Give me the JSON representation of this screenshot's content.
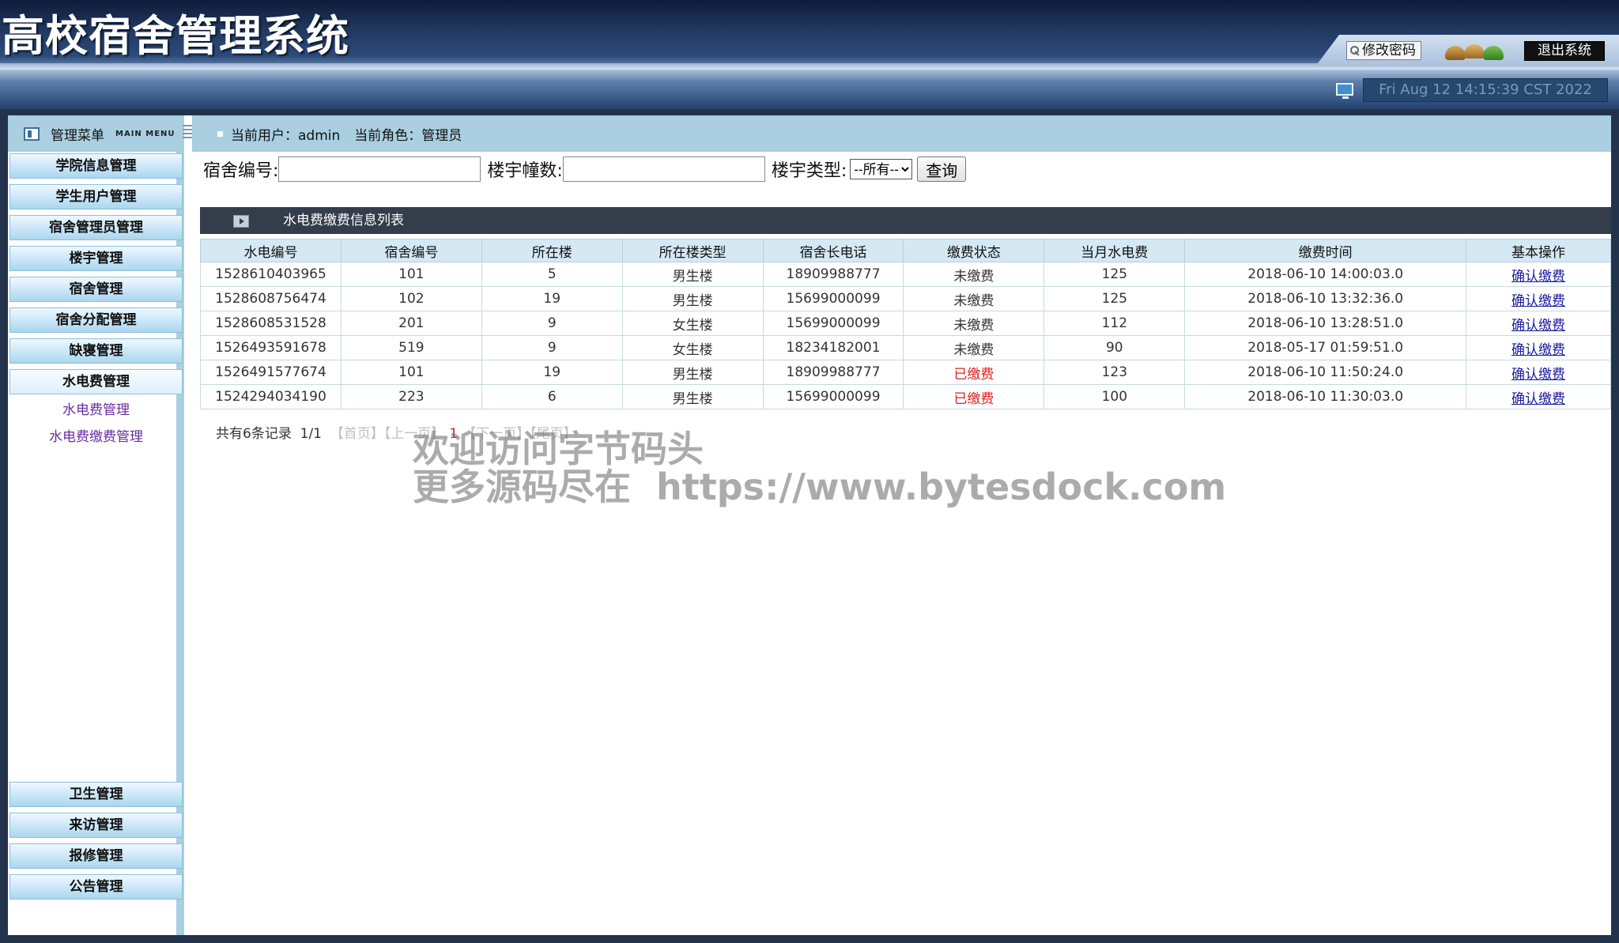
{
  "header": {
    "title": "高校宿舍管理系统",
    "change_password": "修改密码",
    "exit": "退出系统",
    "clock": "Fri Aug 12 14:15:39 CST 2022"
  },
  "sidebar": {
    "title": "管理菜单",
    "title_en": "MAIN MENU",
    "top_items": [
      "学院信息管理",
      "学生用户管理",
      "宿舍管理员管理",
      "楼宇管理",
      "宿舍管理",
      "宿舍分配管理",
      "缺寝管理",
      "水电费管理"
    ],
    "submenu": [
      "水电费管理",
      "水电费缴费管理"
    ],
    "bottom_items": [
      "卫生管理",
      "来访管理",
      "报修管理",
      "公告管理"
    ]
  },
  "content": {
    "user_label": "当前用户：admin",
    "role_label": "当前角色：管理员",
    "search": {
      "dorm_label": "宿舍编号:",
      "building_label": "楼宇幢数:",
      "type_label": "楼宇类型:",
      "type_selected": "--所有--",
      "query_button": "查询"
    },
    "table_title": "水电费缴费信息列表",
    "columns": [
      "水电编号",
      "宿舍编号",
      "所在楼",
      "所在楼类型",
      "宿舍长电话",
      "缴费状态",
      "当月水电费",
      "缴费时间",
      "基本操作"
    ],
    "rows": [
      {
        "id": "1528610403965",
        "dorm": "101",
        "building": "5",
        "type": "男生楼",
        "phone": "18909988777",
        "status": "未缴费",
        "fee": "125",
        "time": "2018-06-10 14:00:03.0",
        "action": "确认缴费"
      },
      {
        "id": "1528608756474",
        "dorm": "102",
        "building": "19",
        "type": "男生楼",
        "phone": "15699000099",
        "status": "未缴费",
        "fee": "125",
        "time": "2018-06-10 13:32:36.0",
        "action": "确认缴费"
      },
      {
        "id": "1528608531528",
        "dorm": "201",
        "building": "9",
        "type": "女生楼",
        "phone": "15699000099",
        "status": "未缴费",
        "fee": "112",
        "time": "2018-06-10 13:28:51.0",
        "action": "确认缴费"
      },
      {
        "id": "1526493591678",
        "dorm": "519",
        "building": "9",
        "type": "女生楼",
        "phone": "18234182001",
        "status": "未缴费",
        "fee": "90",
        "time": "2018-05-17 01:59:51.0",
        "action": "确认缴费"
      },
      {
        "id": "1526491577674",
        "dorm": "101",
        "building": "19",
        "type": "男生楼",
        "phone": "18909988777",
        "status": "已缴费",
        "fee": "123",
        "time": "2018-06-10 11:50:24.0",
        "action": "确认缴费"
      },
      {
        "id": "1524294034190",
        "dorm": "223",
        "building": "6",
        "type": "男生楼",
        "phone": "15699000099",
        "status": "已缴费",
        "fee": "100",
        "time": "2018-06-10 11:30:03.0",
        "action": "确认缴费"
      }
    ],
    "pager": {
      "summary": "共有6条记录",
      "pages": "1/1",
      "first": "【首页】",
      "prev": "【上一页】",
      "current": "1",
      "next": "【下一页】",
      "last": "【尾页】"
    }
  },
  "watermark": {
    "line1": "欢迎访问字节码头",
    "line2": "更多源码尽在  https://www.bytesdock.com"
  },
  "colors": {
    "header_bg": "#223a63",
    "sidebar_head": "#a9cfe0",
    "table_title_bg": "#333d4c",
    "paid_status": "#e02020",
    "link": "#1a1aa0"
  }
}
